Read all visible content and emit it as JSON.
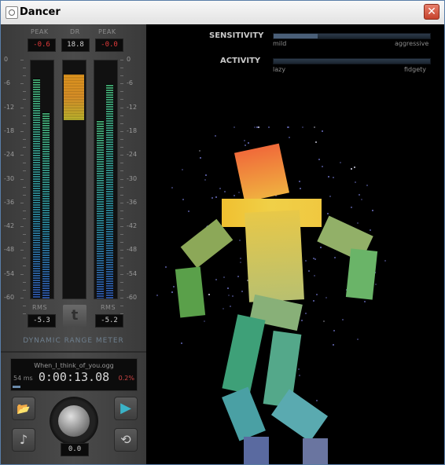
{
  "window": {
    "title": "Dancer",
    "close_label": "✕"
  },
  "meter": {
    "peak_left_label": "PEAK",
    "peak_left_value": "-0.6",
    "dr_label": "DR",
    "dr_value": "18.8",
    "peak_right_label": "PEAK",
    "peak_right_value": "-0.0",
    "scale": [
      "0",
      "-6",
      "-12",
      "-18",
      "-24",
      "-30",
      "-36",
      "-42",
      "-48",
      "-54",
      "-60"
    ],
    "rms_left_label": "RMS",
    "rms_left_value": "-5.3",
    "rms_right_label": "RMS",
    "rms_right_value": "-5.2",
    "logo_letter": "t",
    "title": "DYNAMIC RANGE METER",
    "left_peak_db": -4.5,
    "left_rms_db": -13,
    "right_peak_db": -6,
    "right_rms_db": -15,
    "dr_top_db": -3.5,
    "dr_bottom_db": -15
  },
  "player": {
    "filename": "When_I_think_of_you.ogg",
    "time": "0:00:13.08",
    "latency": "54 ms",
    "percent": "0.2%",
    "volume": "0.0",
    "buttons": {
      "open": "📂",
      "music": "♪",
      "play": "▶",
      "loop": "⟲"
    }
  },
  "controls": {
    "sensitivity_label": "SENSITIVITY",
    "sensitivity_min": "mild",
    "sensitivity_max": "aggressive",
    "sensitivity_value": 0.28,
    "activity_label": "ACTIVITY",
    "activity_min": "lazy",
    "activity_max": "fidgety",
    "activity_value": 0.0
  },
  "colors": {
    "head": "#f07a3a",
    "torso_top": "#eecc40",
    "torso_bottom": "#a8c07a",
    "arm_left": "#6aa050",
    "arm_right": "#7aba68",
    "leg": "#4aa890",
    "feet": "#5a6aa0",
    "particles": "#6e73c8",
    "accent": "#3ab3c8"
  }
}
